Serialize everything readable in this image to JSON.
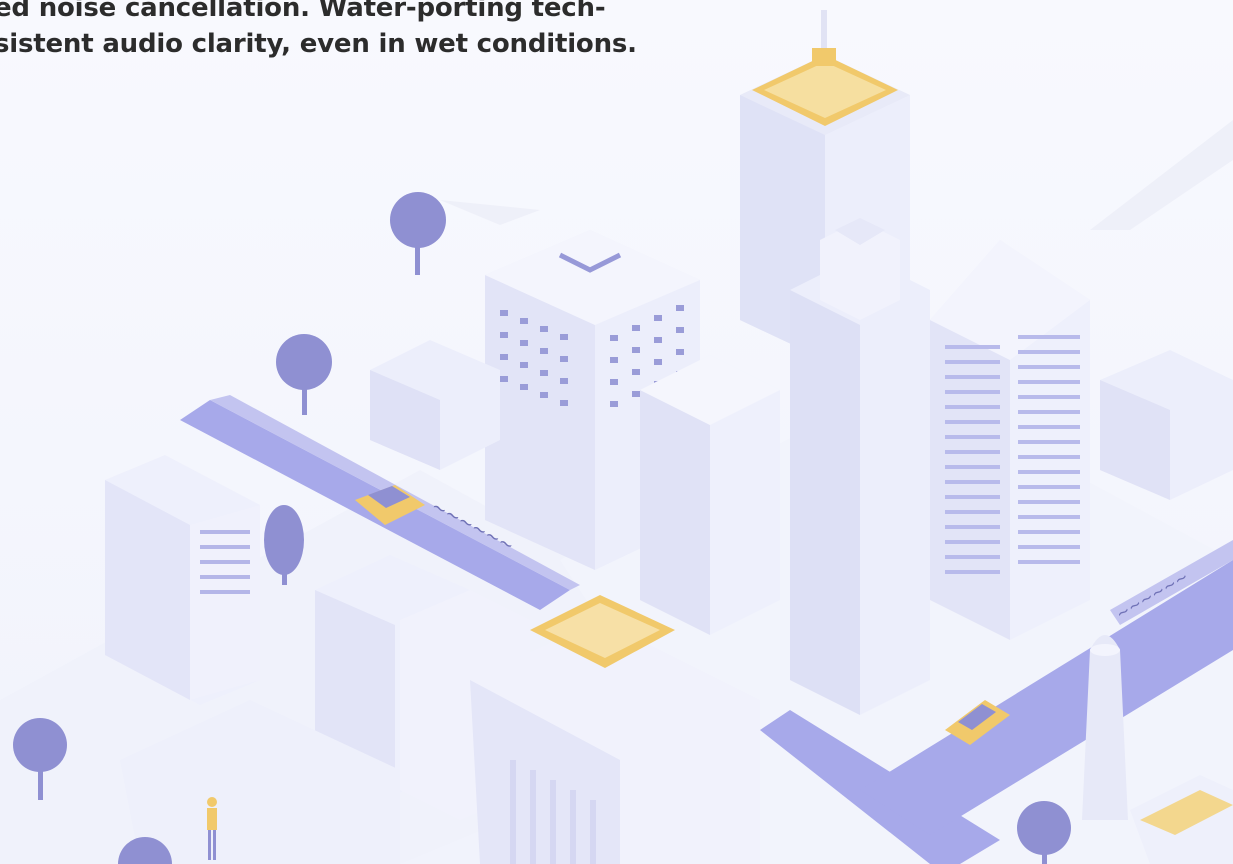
{
  "description": {
    "line_1": "ed noise cancellation. Water-porting tech-",
    "line_2": "sistent audio clarity, even in wet conditions."
  },
  "illustration": {
    "icon": "isometric-city-icon",
    "colors": {
      "background": "#f6f8fd",
      "building_light": "#eef0fb",
      "building_mid": "#e1e3f6",
      "building_shade": "#cfd2ef",
      "road": "#a7a9ea",
      "tree": "#8f90d2",
      "accent_gold": "#f1c96b",
      "text": "#2c2c2c"
    }
  }
}
